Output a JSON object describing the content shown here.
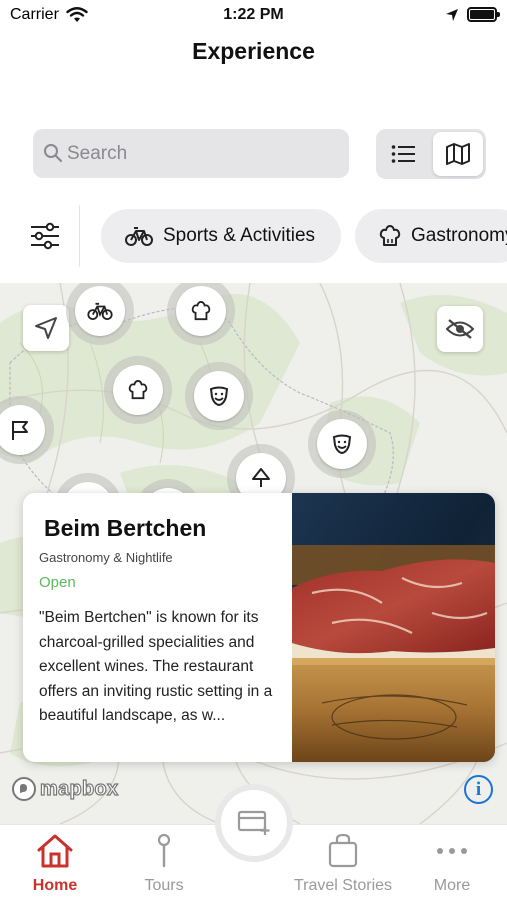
{
  "status_bar": {
    "carrier": "Carrier",
    "time": "1:22 PM"
  },
  "nav": {
    "title": "Experience"
  },
  "search": {
    "placeholder": "Search",
    "icon": "search-icon"
  },
  "view_toggle": {
    "options": [
      "list",
      "map"
    ],
    "selected": "map"
  },
  "filters": {
    "chips": [
      {
        "label": "Sports & Activities",
        "icon": "bicycle-icon"
      },
      {
        "label": "Gastronomy & Nightlife",
        "icon": "chef-hat-icon"
      }
    ]
  },
  "map": {
    "markers": [
      "bicycle",
      "chef-hat",
      "chef-hat",
      "theater-masks",
      "theater-masks",
      "flag",
      "tree"
    ],
    "attribution": "mapbox",
    "info_symbol": "i"
  },
  "card": {
    "title": "Beim Bertchen",
    "category": "Gastronomy & Nightlife",
    "status": "Open",
    "status_color": "#5cb85c",
    "description": "\"Beim Bertchen\" is known for its charcoal-grilled specialities and excellent wines. The restaurant offers an inviting rustic setting in a beautiful landscape, as w..."
  },
  "tabbar": {
    "tabs": [
      {
        "label": "Home",
        "icon": "home-icon",
        "active": true
      },
      {
        "label": "Tours",
        "icon": "pin-icon",
        "active": false
      },
      {
        "label": "Travel Stories",
        "icon": "bag-icon",
        "active": false
      },
      {
        "label": "More",
        "icon": "more-icon",
        "active": false
      }
    ],
    "accent_color": "#c8332b"
  }
}
